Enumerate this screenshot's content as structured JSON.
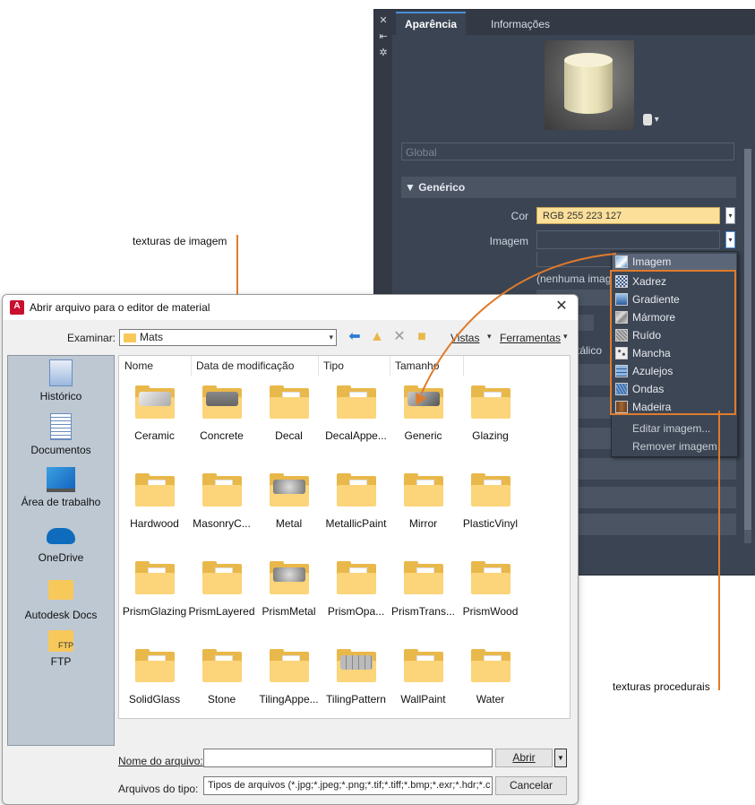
{
  "material_editor": {
    "tabs": [
      "Aparência",
      "Informações"
    ],
    "global_placeholder": "Global",
    "section_header": "Genérico",
    "color_label": "Cor",
    "color_value": "RGB 255 223 127",
    "image_label": "Imagem",
    "no_image_text": "(nenhuma imag",
    "metallic_partial": "tálico"
  },
  "texture_menu": {
    "items": [
      {
        "label": "Imagem",
        "icon": "image-icon"
      },
      {
        "label": "Xadrez",
        "icon": "checker-icon"
      },
      {
        "label": "Gradiente",
        "icon": "gradient-icon"
      },
      {
        "label": "Mármore",
        "icon": "marble-icon"
      },
      {
        "label": "Ruído",
        "icon": "noise-icon"
      },
      {
        "label": "Mancha",
        "icon": "speckle-icon"
      },
      {
        "label": "Azulejos",
        "icon": "tiles-icon"
      },
      {
        "label": "Ondas",
        "icon": "waves-icon"
      },
      {
        "label": "Madeira",
        "icon": "wood-icon"
      }
    ],
    "actions": [
      "Editar imagem...",
      "Remover imagem"
    ]
  },
  "callouts": {
    "image_textures": "texturas de imagem",
    "procedural_textures": "texturas procedurais"
  },
  "dialog": {
    "title": "Abrir arquivo para o editor de material",
    "look_in_label": "Examinar:",
    "look_in_value": "Mats",
    "views_label": "Vistas",
    "tools_label": "Ferramentas",
    "columns": [
      "Nome",
      "Data de modificação",
      "Tipo",
      "Tamanho"
    ],
    "places": [
      "Histórico",
      "Documentos",
      "Área de trabalho",
      "OneDrive",
      "Autodesk Docs",
      "FTP"
    ],
    "files": [
      "Ceramic",
      "Concrete",
      "Decal",
      "DecalAppe...",
      "Generic",
      "Glazing",
      "Hardwood",
      "MasonryC...",
      "Metal",
      "MetallicPaint",
      "Mirror",
      "PlasticVinyl",
      "PrismGlazing",
      "PrismLayered",
      "PrismMetal",
      "PrismOpa...",
      "PrismTrans...",
      "PrismWood",
      "SolidGlass",
      "Stone",
      "TilingAppe...",
      "TilingPattern",
      "WallPaint",
      "Water"
    ],
    "filename_label": "Nome do arquivo:",
    "filename_value": "",
    "filetype_label": "Arquivos do tipo:",
    "filetype_value": "Tipos de arquivos (*.jpg;*.jpeg;*.png;*.tif;*.tiff;*.bmp;*.exr;*.hdr;*.c",
    "open_button": "Abrir",
    "cancel_button": "Cancelar"
  },
  "colors": {
    "panel_bg": "#3b4453",
    "accent_orange": "#e07b2c",
    "color_swatch": "#fce09a",
    "folder_yellow": "#fcd47a"
  }
}
